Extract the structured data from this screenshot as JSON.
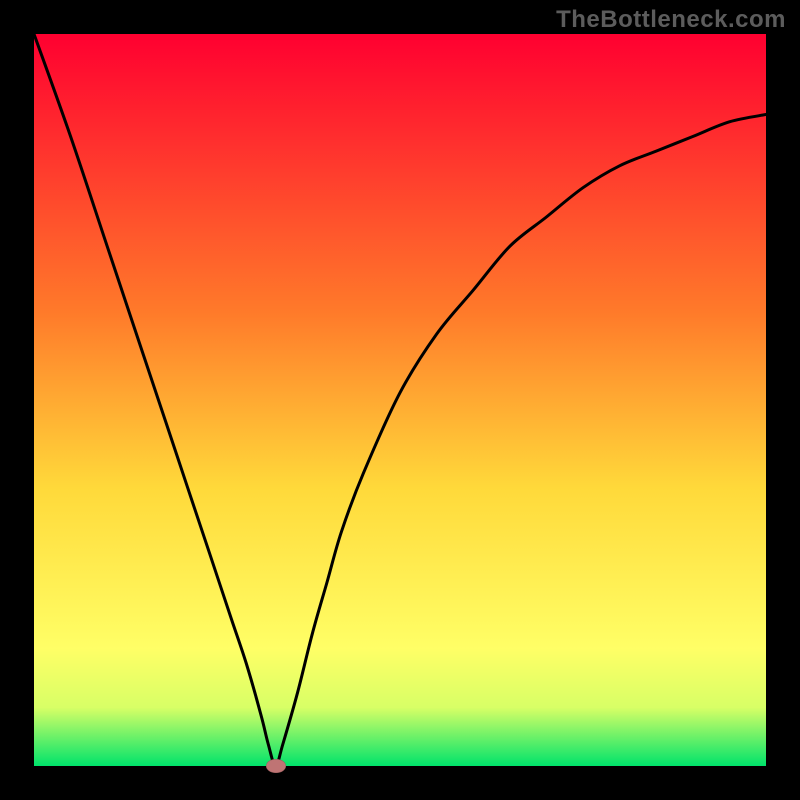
{
  "watermark": "TheBottleneck.com",
  "colors": {
    "top": "#ff0030",
    "mid1": "#ff7a2a",
    "mid2": "#ffd93a",
    "mid3": "#ffff66",
    "mid4": "#d8ff66",
    "bottom": "#00e36b",
    "curve": "#000000",
    "frame": "#000000",
    "marker": "#bf7474",
    "watermark_text": "#5c5c5c"
  },
  "chart_data": {
    "type": "line",
    "title": "",
    "xlabel": "",
    "ylabel": "",
    "xlim": [
      0,
      100
    ],
    "ylim": [
      0,
      100
    ],
    "grid": false,
    "legend": false,
    "series": [
      {
        "name": "bottleneck-curve",
        "x": [
          0,
          5,
          10,
          15,
          18,
          21,
          24,
          27,
          29,
          31,
          32,
          33,
          34,
          36,
          38,
          40,
          42,
          45,
          50,
          55,
          60,
          65,
          70,
          75,
          80,
          85,
          90,
          95,
          100
        ],
        "y": [
          100,
          86,
          71,
          56,
          47,
          38,
          29,
          20,
          14,
          7,
          3,
          0,
          3,
          10,
          18,
          25,
          32,
          40,
          51,
          59,
          65,
          71,
          75,
          79,
          82,
          84,
          86,
          88,
          89
        ]
      }
    ],
    "annotations": [
      {
        "name": "min-marker",
        "x": 33,
        "y": 0
      }
    ]
  }
}
